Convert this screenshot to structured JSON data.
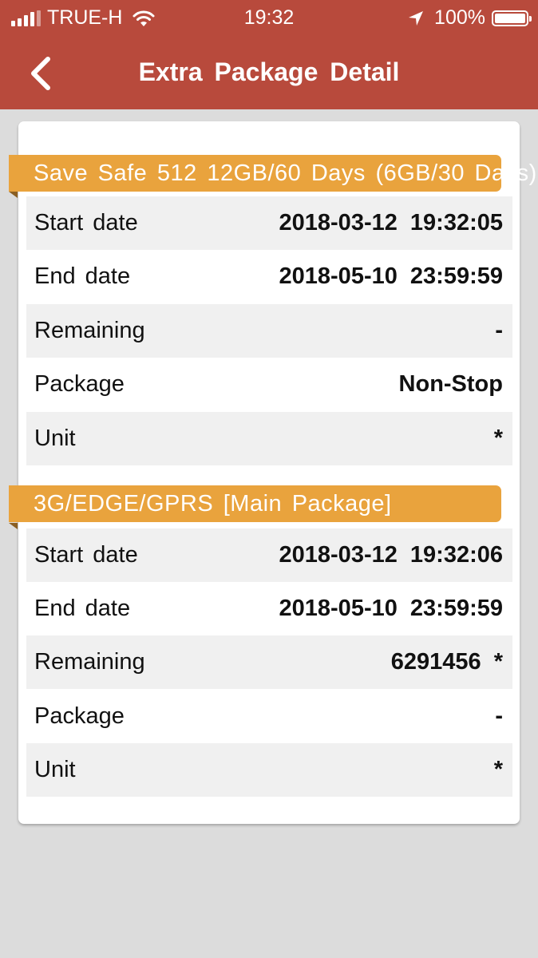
{
  "status_bar": {
    "carrier": "TRUE-H",
    "time": "19:32",
    "battery": "100%"
  },
  "nav": {
    "title": "Extra Package Detail"
  },
  "packages": [
    {
      "name": "Save Safe 512 12GB/60 Days (6GB/30 Days)",
      "rows": [
        {
          "label": "Start date",
          "value": "2018-03-12 19:32:05"
        },
        {
          "label": "End date",
          "value": "2018-05-10 23:59:59"
        },
        {
          "label": "Remaining",
          "value": "-"
        },
        {
          "label": "Package",
          "value": "Non-Stop"
        },
        {
          "label": "Unit",
          "value": "*"
        }
      ]
    },
    {
      "name": "3G/EDGE/GPRS [Main Package]",
      "rows": [
        {
          "label": "Start date",
          "value": "2018-03-12 19:32:06"
        },
        {
          "label": "End date",
          "value": "2018-05-10 23:59:59"
        },
        {
          "label": "Remaining",
          "value": "6291456 *"
        },
        {
          "label": "Package",
          "value": "-"
        },
        {
          "label": "Unit",
          "value": "*"
        }
      ]
    }
  ],
  "colors": {
    "header": "#b84a3c",
    "section_header": "#e9a33d",
    "background": "#dcdcdc"
  }
}
